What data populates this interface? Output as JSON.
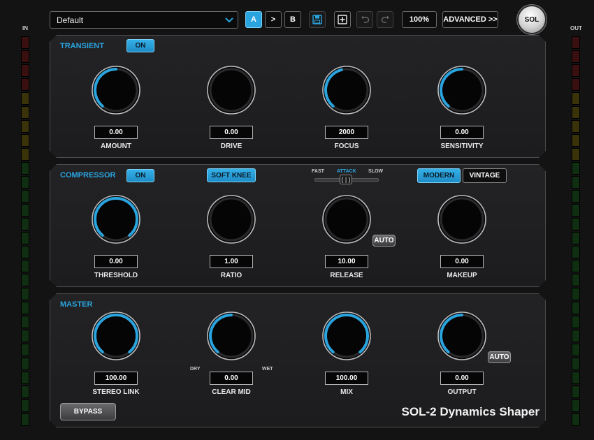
{
  "toolbar": {
    "preset_value": "Default",
    "a_label": "A",
    "copy_label": ">",
    "b_label": "B",
    "zoom_label": "100%",
    "advanced_label": "ADVANCED >>",
    "logo_label": "SOL"
  },
  "meters": {
    "in_label": "IN",
    "out_label": "OUT"
  },
  "transient": {
    "title": "TRANSIENT",
    "on_label": "ON",
    "knobs": [
      {
        "label": "AMOUNT",
        "value": "0.00",
        "level": 0.5
      },
      {
        "label": "DRIVE",
        "value": "0.00",
        "level": 0.0
      },
      {
        "label": "FOCUS",
        "value": "2000",
        "level": 0.45
      },
      {
        "label": "SENSITIVITY",
        "value": "0.00",
        "level": 0.5
      }
    ]
  },
  "compressor": {
    "title": "COMPRESSOR",
    "on_label": "ON",
    "soft_knee_label": "SOFT KNEE",
    "attack": {
      "fast_label": "FAST",
      "attack_label": "ATTACK",
      "slow_label": "SLOW",
      "handle_label": "( | )"
    },
    "modern_label": "MODERN",
    "vintage_label": "VINTAGE",
    "auto_label": "AUTO",
    "knobs": [
      {
        "label": "THRESHOLD",
        "value": "0.00",
        "level": 1.0
      },
      {
        "label": "RATIO",
        "value": "1.00",
        "level": 0.0
      },
      {
        "label": "RELEASE",
        "value": "10.00",
        "level": 0.0
      },
      {
        "label": "MAKEUP",
        "value": "0.00",
        "level": 0.0
      }
    ]
  },
  "master": {
    "title": "MASTER",
    "dry_label": "DRY",
    "wet_label": "WET",
    "auto_label": "AUTO",
    "bypass_label": "BYPASS",
    "knobs": [
      {
        "label": "STEREO LINK",
        "value": "100.00",
        "level": 1.0
      },
      {
        "label": "CLEAR MID",
        "value": "0.00",
        "level": 0.5
      },
      {
        "label": "MIX",
        "value": "100.00",
        "level": 1.0
      },
      {
        "label": "OUTPUT",
        "value": "0.00",
        "level": 0.5
      }
    ]
  },
  "product_name": "SOL-2 Dynamics Shaper",
  "colors": {
    "accent": "#2aa4df",
    "panel": "#1f1f21",
    "background": "#131314"
  }
}
